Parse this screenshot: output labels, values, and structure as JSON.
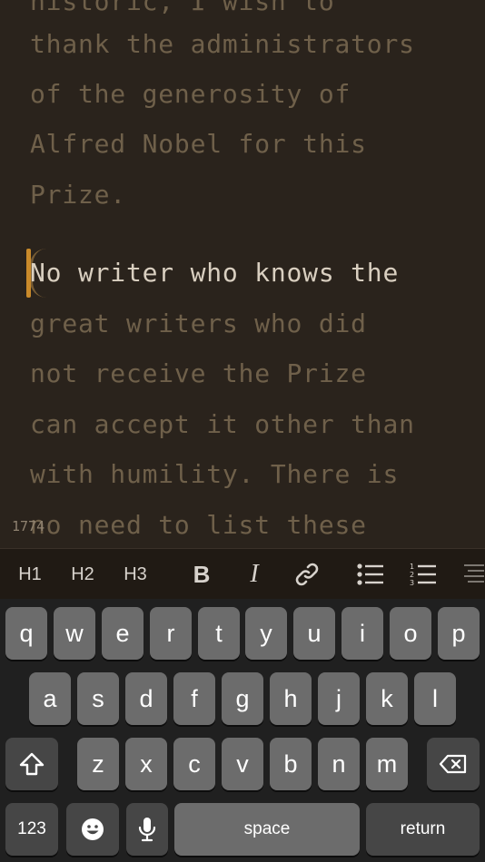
{
  "editor": {
    "lines": [
      "historic, I wish to",
      "thank the administrators",
      "of the generosity of",
      "Alfred Nobel for this",
      "Prize.",
      "No writer who knows the",
      "great writers who did",
      "not receive the Prize",
      "can accept it other than",
      "with humility. There is",
      "no need to list these"
    ],
    "char_count": "1774"
  },
  "toolbar": {
    "h1": "H1",
    "h2": "H2",
    "h3": "H3",
    "bold": "B",
    "italic": "I"
  },
  "keyboard": {
    "row1": [
      "q",
      "w",
      "e",
      "r",
      "t",
      "y",
      "u",
      "i",
      "o",
      "p"
    ],
    "row2": [
      "a",
      "s",
      "d",
      "f",
      "g",
      "h",
      "j",
      "k",
      "l"
    ],
    "row3": [
      "z",
      "x",
      "c",
      "v",
      "b",
      "n",
      "m"
    ],
    "numbers_label": "123",
    "space_label": "space",
    "return_label": "return"
  },
  "colors": {
    "background": "#2a231c",
    "inactive_text": "#6f604a",
    "active_text": "#d9cfc0",
    "cursor": "#c98a2a"
  }
}
